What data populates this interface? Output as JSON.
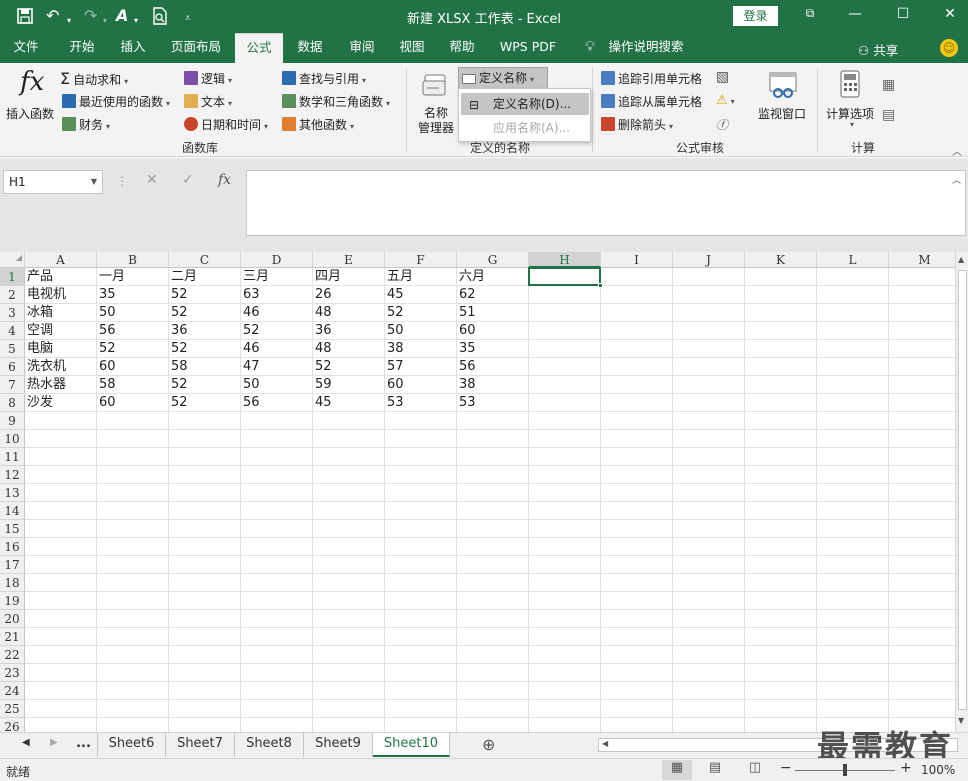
{
  "titlebar": {
    "title": "新建 XLSX 工作表 - Excel",
    "login_label": "登录",
    "icons": [
      "save-icon",
      "undo-icon",
      "redo-icon",
      "format-painter-icon",
      "print-preview-icon",
      "customize-qat-icon"
    ]
  },
  "tabs": [
    "文件",
    "开始",
    "插入",
    "页面布局",
    "公式",
    "数据",
    "审阅",
    "视图",
    "帮助",
    "WPS PDF",
    "操作说明搜索"
  ],
  "active_tab": "公式",
  "share_label": "共享",
  "ribbon": {
    "insert_function": "插入函数",
    "autosum": "自动求和",
    "recent": "最近使用的函数",
    "financial": "财务",
    "logical": "逻辑",
    "text": "文本",
    "datetime": "日期和时间",
    "lookup": "查找与引用",
    "math": "数学和三角函数",
    "more": "其他函数",
    "group_library": "函数库",
    "name_manager_1": "名称",
    "name_manager_2": "管理器",
    "define_name": "定义名称",
    "group_defined": "定义的名称",
    "trace_precedents": "追踪引用单元格",
    "trace_dependents": "追踪从属单元格",
    "remove_arrows": "删除箭头",
    "group_audit": "公式审核",
    "watch_window": "监视窗口",
    "calc_options": "计算选项",
    "group_calc": "计算"
  },
  "dropdown": {
    "define_name_item": "定义名称(D)...",
    "apply_names_item": "应用名称(A)..."
  },
  "formula_bar": {
    "name_box": "H1",
    "formula": ""
  },
  "grid": {
    "columns": [
      "A",
      "B",
      "C",
      "D",
      "E",
      "F",
      "G",
      "H",
      "I",
      "J",
      "K",
      "L",
      "M"
    ],
    "selected_column": "H",
    "selected_cell": "H1",
    "row_count": 26,
    "rows": [
      [
        "产品",
        "一月",
        "二月",
        "三月",
        "四月",
        "五月",
        "六月"
      ],
      [
        "电视机",
        "35",
        "52",
        "63",
        "26",
        "45",
        "62"
      ],
      [
        "冰箱",
        "50",
        "52",
        "46",
        "48",
        "52",
        "51"
      ],
      [
        "空调",
        "56",
        "36",
        "52",
        "36",
        "50",
        "60"
      ],
      [
        "电脑",
        "52",
        "52",
        "46",
        "48",
        "38",
        "35"
      ],
      [
        "洗衣机",
        "60",
        "58",
        "47",
        "52",
        "57",
        "56"
      ],
      [
        "热水器",
        "58",
        "52",
        "50",
        "59",
        "60",
        "38"
      ],
      [
        "沙发",
        "60",
        "52",
        "56",
        "45",
        "53",
        "53"
      ]
    ]
  },
  "sheets": {
    "ellipsis": "...",
    "tabs": [
      "Sheet6",
      "Sheet7",
      "Sheet8",
      "Sheet9",
      "Sheet10"
    ],
    "active": "Sheet10"
  },
  "status": {
    "ready": "就绪",
    "zoom": "100%"
  },
  "watermark": "最需教育",
  "colors": {
    "accent": "#217346"
  }
}
